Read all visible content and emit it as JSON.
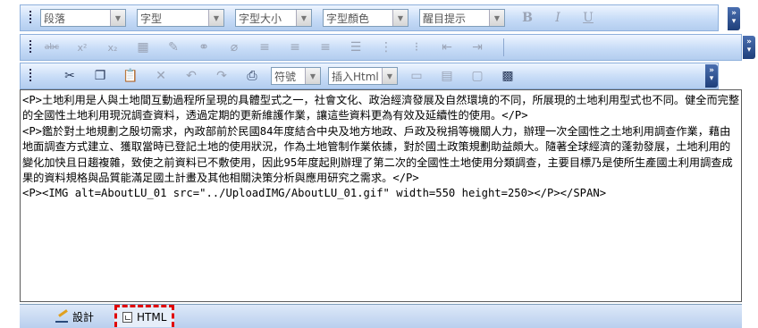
{
  "toolbar1": {
    "paragraph_select": "段落",
    "font_select": "字型",
    "size_select": "字型大小",
    "color_select": "字型顏色",
    "highlight_select": "醒目提示",
    "bold": "B",
    "italic": "I",
    "underline": "U"
  },
  "toolbar2": {
    "strike_label": "abc",
    "sup_label": "x²",
    "sub_label": "x₂"
  },
  "toolbar3": {
    "symbol_select": "符號",
    "insert_html_select": "插入Html"
  },
  "editor": {
    "lines": [
      "<P>土地利用是人與土地間互動過程所呈現的具體型式之一，社會文化、政治經濟發展及自然環境的不同，所展現的土地利用型式也不同。健全而完整的全國性土地利用現況調查資料，透過定期的更新維護作業，讓這些資料更為有效及延續性的使用。</P>",
      "<P>鑑於對土地規劃之殷切需求，內政部前於民國84年度結合中央及地方地政、戶政及稅捐等機關人力，辦理一次全國性之土地利用調查作業，藉由地面調查方式建立、獲取當時已登記土地的使用狀況，作為土地管制作業依據，對於國土政策規劃助益頗大。隨著全球經濟的蓬勃發展，土地利用的變化加快且日趨複雜，致使之前資料已不敷使用，因此95年度起則辦理了第二次的全國性土地使用分類調查，主要目標乃是使所生產國土利用調查成果的資料規格與品質能滿足國土計畫及其他相關決策分析與應用研究之需求。</P>",
      "<P><IMG alt=AboutLU_01 src=\"../UploadIMG/AboutLU_01.gif\" width=550 height=250></P></SPAN>"
    ]
  },
  "tabs": {
    "design_label": "設計",
    "html_label": "HTML"
  }
}
